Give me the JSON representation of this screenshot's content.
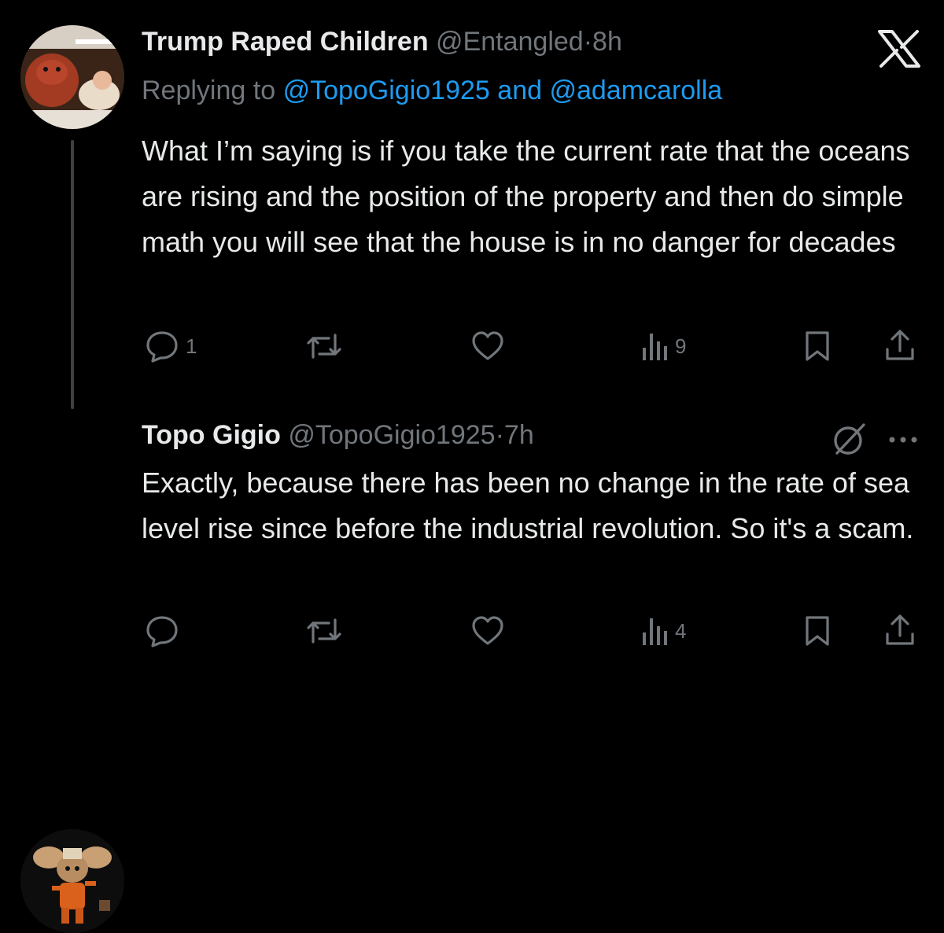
{
  "brand": {
    "x_logo": "X",
    "link_color": "#1d9bf0",
    "muted_color": "#71767b"
  },
  "tweets": [
    {
      "display_name": "Trump Raped Children",
      "handle": "@Entangled",
      "separator": "·",
      "time": "8h",
      "replying_prefix": "Replying to",
      "replying_user1": "@TopoGigio1925",
      "replying_and": "and",
      "replying_user2": "@adamcarolla",
      "text": "What I’m saying is if you take the current rate that the oceans are rising and the position of the property and then do simple math you will see that the house is in no danger for decades",
      "reply_count": "1",
      "view_count": "9",
      "icons": [
        "reply-icon",
        "retweet-icon",
        "like-icon",
        "views-icon",
        "bookmark-icon",
        "share-icon"
      ]
    },
    {
      "display_name": "Topo Gigio",
      "handle": "@TopoGigio1925",
      "separator": "·",
      "time": "7h",
      "text": "Exactly, because there has been no change in the rate of sea level rise since before the industrial revolution. So it's a scam.",
      "view_count": "4",
      "icons": [
        "grok-icon",
        "more-icon",
        "reply-icon",
        "retweet-icon",
        "like-icon",
        "views-icon",
        "bookmark-icon",
        "share-icon"
      ]
    }
  ]
}
